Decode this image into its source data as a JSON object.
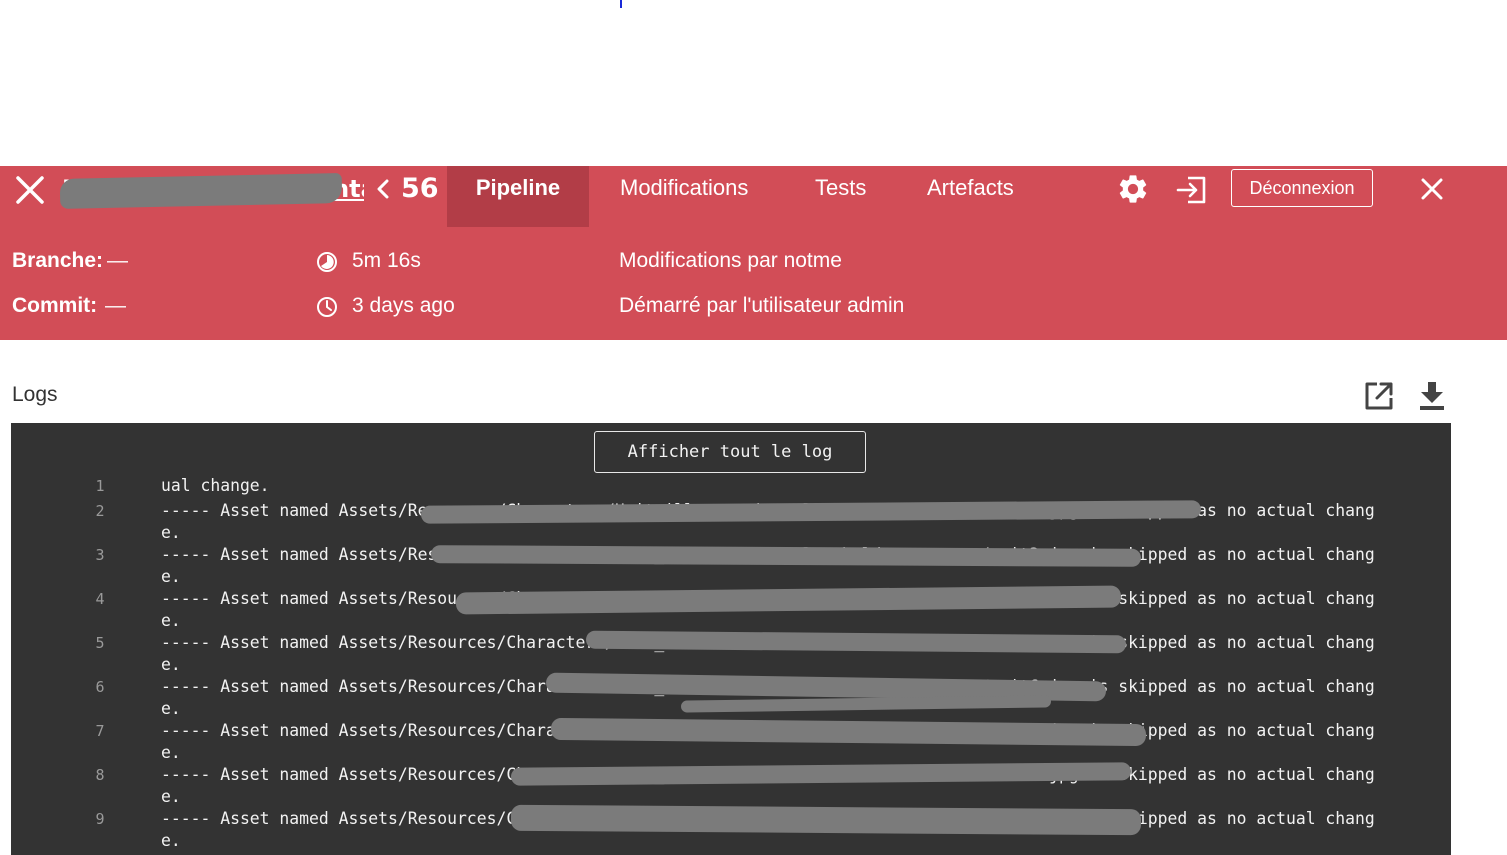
{
  "header": {
    "pipeline_name": "Imprimatur incremental",
    "run_number": "56",
    "tabs": [
      {
        "label": "Pipeline",
        "active": true
      },
      {
        "label": "Modifications",
        "active": false
      },
      {
        "label": "Tests",
        "active": false
      },
      {
        "label": "Artefacts",
        "active": false
      }
    ],
    "logout_label": "Déconnexion",
    "icons": [
      "close-icon",
      "chevron-left-icon",
      "gear-icon",
      "sign-out-icon",
      "close-icon"
    ]
  },
  "info": {
    "branch_label": "Branche:",
    "branch_value": "—",
    "commit_label": "Commit:",
    "commit_value": "—",
    "duration": "5m 16s",
    "started": "3 days ago",
    "changes_by": "Modifications par notme",
    "started_by": "Démarré par l'utilisateur admin"
  },
  "logs": {
    "title": "Logs",
    "show_all_label": "Afficher tout le log",
    "lines": [
      {
        "n": "1",
        "text": "ual change."
      },
      {
        "n": "2",
        "text": "----- Asset named Assets/Resources/Characters/Unit_illustration/Placeholders-assets/unit2.jpg is skipped as no actual change."
      },
      {
        "n": "3",
        "text": "----- Asset named Assets/Resources/Characters/Unit_illustration/Placeholders-assets/unit3.jpg is skipped as no actual change."
      },
      {
        "n": "4",
        "text": "----- Asset named Assets/Resources/Characters/Unit_illustration/Placeholders-assets/unit4.jpg is skipped as no actual change."
      },
      {
        "n": "5",
        "text": "----- Asset named Assets/Resources/Characters/Unit_illustration/Placeholders-assets/unit5.jpg is skipped as no actual change."
      },
      {
        "n": "6",
        "text": "----- Asset named Assets/Resources/Characters/Unit_illustration/Placeholders-assets/unit6.jpg is skipped as no actual change."
      },
      {
        "n": "7",
        "text": "----- Asset named Assets/Resources/Characters/Unit_illustration/Placeholders-assets/unit7.jpg is skipped as no actual change."
      },
      {
        "n": "8",
        "text": "----- Asset named Assets/Resources/Characters/Unit_illustration/Placeholders-assets/unit8.jpg is skipped as no actual change."
      },
      {
        "n": "9",
        "text": "----- Asset named Assets/Resources/Characters/Unit_illustration/Placeholders-assets/unit1.jpg is skipped as no actual change."
      }
    ]
  },
  "colors": {
    "brand_red": "#d24d57",
    "active_tab": "#b23d47",
    "console_bg": "#333333"
  }
}
